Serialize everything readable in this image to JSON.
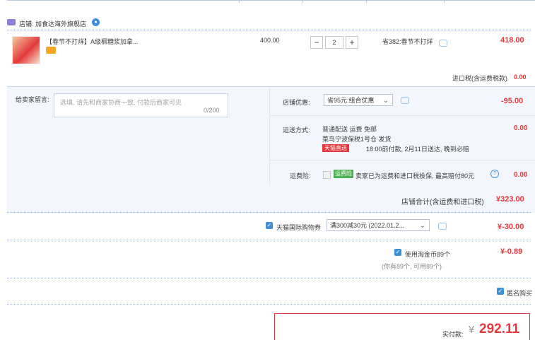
{
  "shop": {
    "name": "店铺: 加食达海外旗舰店"
  },
  "product": {
    "title": "【春节不打烊】A级枫糖浆加拿...",
    "unit_price": "400.00",
    "quantity": "2",
    "promo": "省382:春节不打烊",
    "subtotal": "418.00"
  },
  "import_tax": {
    "label": "进口税(含运费税款)",
    "value": "0.00"
  },
  "message": {
    "label": "给卖家留言:",
    "placeholder": "选填, 请先和商家协商一致, 付款后商家可见",
    "counter": "0/200"
  },
  "shop_discount": {
    "label": "店铺优惠:",
    "selected": "省95元:组合优惠",
    "value": "-95.00"
  },
  "shipping": {
    "label": "运送方式:",
    "line1": "普通配送 运费 免邮",
    "line2": "菜鸟宁波保税1号仓  发货",
    "badge": "天猫直送",
    "line3": "18:00前付款, 2月11日送达, 晚到必赔",
    "value": "0.00"
  },
  "insurance": {
    "label": "运费险:",
    "tag": "运费险",
    "text": "卖家已为运费和进口税投保, 最高赔付80元",
    "value": "0.00"
  },
  "shop_total": {
    "label": "店铺合计(含运费和进口税)",
    "value": "¥323.00"
  },
  "coupon": {
    "label": "天猫国际购物券",
    "selected": "满300减30元 (2022.01.2...",
    "value": "¥-30.00"
  },
  "coins": {
    "label": "使用淘金币89个",
    "hint": "(你有89个, 可用89个)",
    "value": "¥-0.89"
  },
  "anonymous": {
    "label": "匿名购买"
  },
  "payment": {
    "label": "实付款:",
    "currency": "¥",
    "amount": "292.11"
  },
  "colors": {
    "accent": "#e4393c",
    "link_blue": "#3d8fd6",
    "panel_bg": "#f3f7fd"
  }
}
